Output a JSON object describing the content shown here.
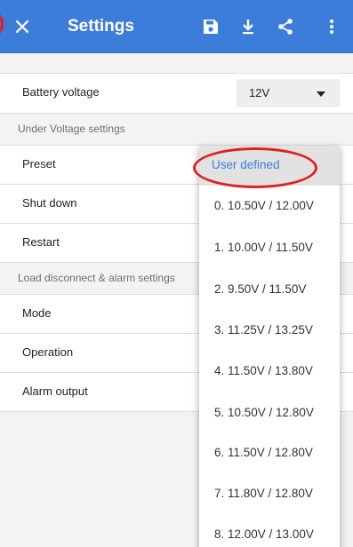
{
  "app_bar": {
    "title": "Settings",
    "close_icon": "close-icon",
    "save_icon": "save-icon",
    "download_icon": "download-icon",
    "share_icon": "share-icon",
    "more_icon": "more-vert-icon",
    "color": "#3b7dd8"
  },
  "battery": {
    "label": "Battery voltage",
    "value": "12V"
  },
  "under_voltage": {
    "header": "Under Voltage settings",
    "rows": [
      {
        "label": "Preset"
      },
      {
        "label": "Shut down"
      },
      {
        "label": "Restart"
      }
    ]
  },
  "load_disconnect": {
    "header": "Load disconnect & alarm settings",
    "rows": [
      {
        "label": "Mode"
      },
      {
        "label": "Operation"
      },
      {
        "label": "Alarm output"
      }
    ]
  },
  "dropdown": {
    "selected": "User defined",
    "options": [
      "User defined",
      "0. 10.50V / 12.00V",
      "1. 10.00V / 11.50V",
      "2. 9.50V / 11.50V",
      "3. 11.25V / 13.25V",
      "4. 11.50V / 13.80V",
      "5. 10.50V / 12.80V",
      "6. 11.50V / 12.80V",
      "7. 11.80V / 12.80V",
      "8. 12.00V / 13.00V"
    ],
    "selected_color": "#3b7dd8"
  },
  "annotation_color": "#e02020"
}
